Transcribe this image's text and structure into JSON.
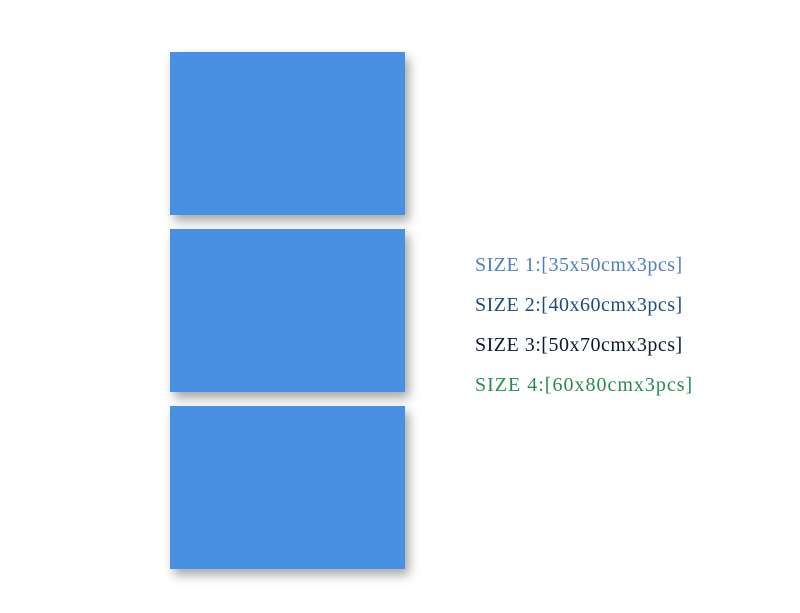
{
  "sizes": [
    {
      "label": "SIZE 1:",
      "value": "35x50cmx3pcs"
    },
    {
      "label": "SIZE 2:",
      "value": "40x60cmx3pcs"
    },
    {
      "label": "SIZE 3:",
      "value": "50x70cmx3pcs"
    },
    {
      "label": "SIZE 4:",
      "value": "60x80cmx3pcs"
    }
  ],
  "panel_color": "#4a90e2",
  "panel_count": 3
}
